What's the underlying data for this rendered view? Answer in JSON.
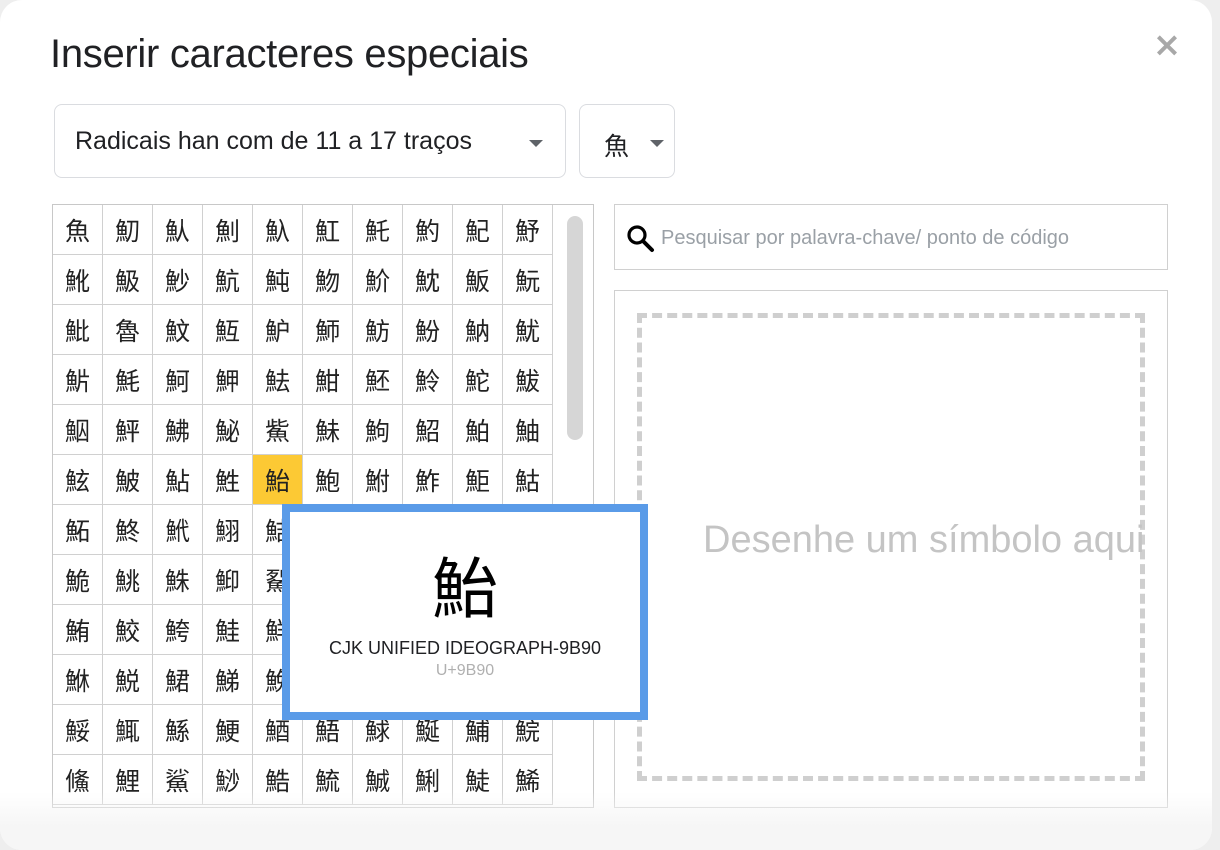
{
  "dialog": {
    "title": "Inserir caracteres especiais",
    "close_label": "×"
  },
  "category_dropdown": {
    "selected": "Radicais han com de 11 a 17 traços"
  },
  "radical_dropdown": {
    "selected": "魚"
  },
  "characters": [
    "魚",
    "魛",
    "魜",
    "魝",
    "魞",
    "魟",
    "魠",
    "魡",
    "魢",
    "魣",
    "魤",
    "魥",
    "魦",
    "魧",
    "魨",
    "魩",
    "魪",
    "魫",
    "魬",
    "魭",
    "魮",
    "魯",
    "魰",
    "魱",
    "魲",
    "魳",
    "魴",
    "魵",
    "魶",
    "魷",
    "魸",
    "魹",
    "魺",
    "魻",
    "魼",
    "魽",
    "魾",
    "魿",
    "鮀",
    "鮁",
    "鮂",
    "鮃",
    "鮄",
    "鮅",
    "鮆",
    "鮇",
    "鮈",
    "鮉",
    "鮊",
    "鮋",
    "鮌",
    "鮍",
    "鮎",
    "鮏",
    "鮐",
    "鮑",
    "鮒",
    "鮓",
    "鮔",
    "鮕",
    "鮖",
    "鮗",
    "鮘",
    "鮙",
    "鮚",
    "鮛",
    "鮜",
    "鮝",
    "鮞",
    "鮟",
    "鮠",
    "鮡",
    "鮢",
    "鮣",
    "鮤",
    "鮥",
    "鮦",
    "鮧",
    "鮨",
    "鮩",
    "鮪",
    "鮫",
    "鮬",
    "鮭",
    "鮮",
    "鮯",
    "鮰",
    "鮱",
    "鮲",
    "鮳",
    "鮴",
    "鮵",
    "鮶",
    "鮷",
    "鮸",
    "鮹",
    "鮺",
    "鮻",
    "鮼",
    "鮽",
    "鮾",
    "鮿",
    "鯀",
    "鯁",
    "鯂",
    "鯃",
    "鯄",
    "鯅",
    "鯆",
    "鯇",
    "鯈",
    "鯉",
    "鯊",
    "鯋",
    "鯌",
    "鯍",
    "鯎",
    "鯏",
    "鯐",
    "鯑"
  ],
  "selected_index": 54,
  "search": {
    "placeholder": "Pesquisar por palavra-chave/ ponto de código",
    "value": ""
  },
  "draw_area": {
    "hint": "Desenhe um símbolo aqui"
  },
  "tooltip": {
    "glyph": "鮐",
    "name": "CJK UNIFIED IDEOGRAPH-9B90",
    "code": "U+9B90"
  },
  "colors": {
    "selected_cell": "#fcc934",
    "tooltip_border": "#5a9be8"
  }
}
